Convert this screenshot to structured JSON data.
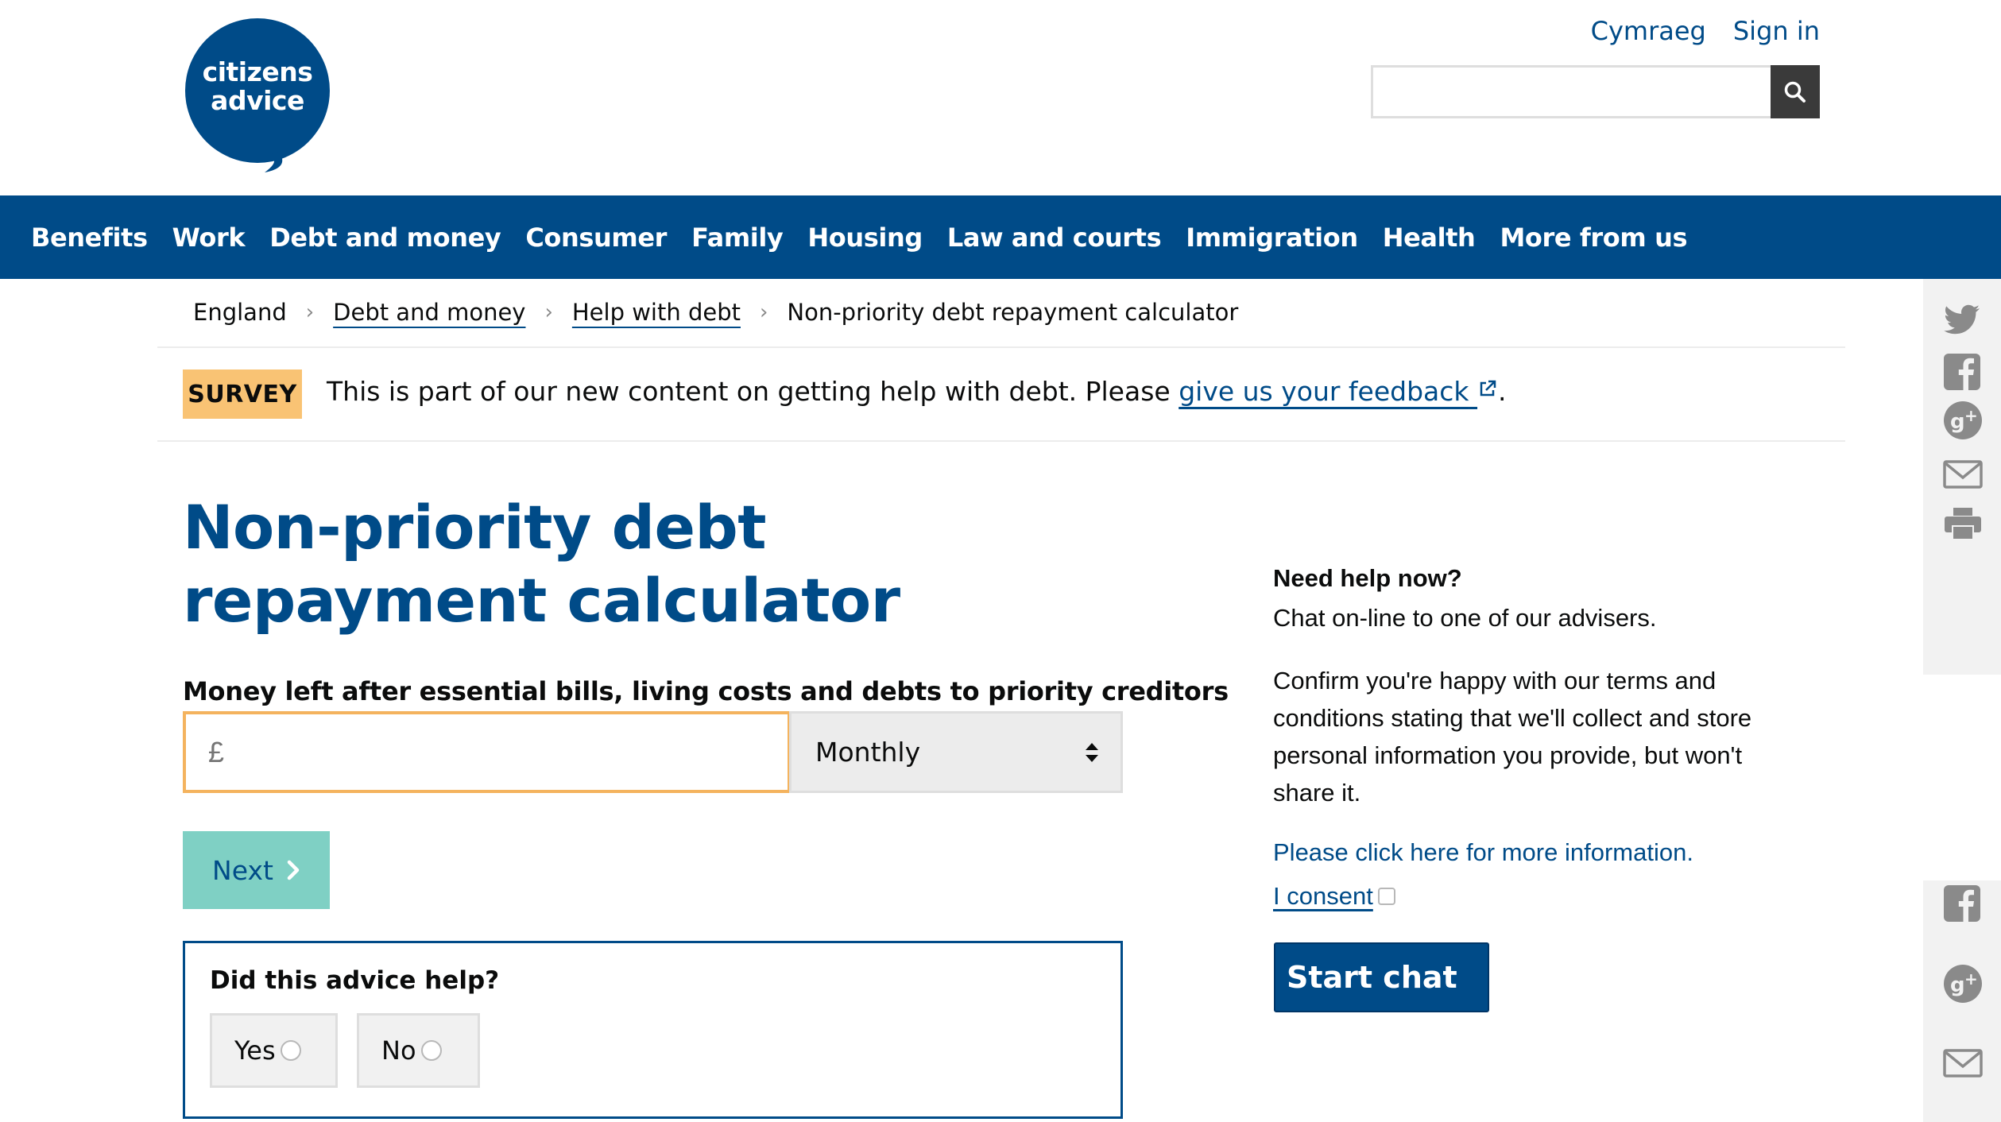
{
  "header": {
    "logo_text_line1": "citizens",
    "logo_text_line2": "advice",
    "links": [
      "Cymraeg",
      "Sign in"
    ],
    "search": {
      "value": "",
      "placeholder": ""
    }
  },
  "nav": {
    "items": [
      "Benefits",
      "Work",
      "Debt and money",
      "Consumer",
      "Family",
      "Housing",
      "Law and courts",
      "Immigration",
      "Health",
      "More from us"
    ]
  },
  "breadcrumb": {
    "items": [
      "England",
      "Debt and money",
      "Help with debt",
      "Non-priority debt repayment calculator"
    ]
  },
  "survey": {
    "badge": "SURVEY",
    "text": "This is part of our new content on getting help with debt. Please ",
    "link": "give us your feedback",
    "suffix": "."
  },
  "main": {
    "title": "Non-priority debt repayment calculator",
    "field_label": "Money left after essential bills, living costs and debts to priority creditors",
    "money_input": {
      "value": "",
      "placeholder": "£"
    },
    "frequency": "Monthly",
    "next_label": "Next"
  },
  "feedback": {
    "question": "Did this advice help?",
    "options": [
      "Yes",
      "No"
    ]
  },
  "chat": {
    "heading": "Need help now?",
    "subtext": "Chat on-line to one of our advisers.",
    "terms": "Confirm you're happy with our terms and conditions stating that we'll collect and store personal information you provide, but won't share it.",
    "info_link": "Please click here for more information.",
    "consent_label": "I consent",
    "start_label": "Start chat"
  },
  "share_icons": [
    "twitter-icon",
    "facebook-icon",
    "google-plus-icon",
    "email-icon",
    "print-icon"
  ],
  "colors": {
    "brand_blue": "#004b88",
    "survey_badge": "#f9c374",
    "next_button": "#7fd0c4",
    "input_focus": "#f4b35e"
  }
}
